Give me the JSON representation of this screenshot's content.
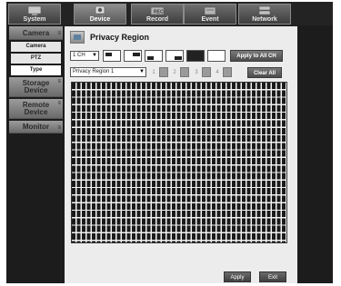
{
  "topnav": {
    "tabs": [
      {
        "label": "System",
        "icon": "system-monitor-icon"
      },
      {
        "label": "Device",
        "icon": "camera-icon"
      },
      {
        "label": "Record",
        "icon": "record-icon"
      },
      {
        "label": "Event",
        "icon": "event-icon"
      },
      {
        "label": "Network",
        "icon": "network-icon"
      }
    ],
    "active": "Device"
  },
  "sidebar": {
    "camera": {
      "label": "Camera",
      "subs": [
        "Camera",
        "PTZ",
        "Type"
      ]
    },
    "storage": {
      "label1": "Storage",
      "label2": "Device"
    },
    "remote": {
      "label1": "Remote",
      "label2": "Device"
    },
    "monitor": {
      "label": "Monitor"
    }
  },
  "main": {
    "title": "Privacy Region",
    "channel_select": "1 CH",
    "apply_all_label": "Apply to All CH",
    "region_select": "Privacy Region 1",
    "region_numbers": [
      "1",
      "2",
      "3",
      "4"
    ],
    "clear_all_label": "Clear All",
    "apply_label": "Apply",
    "exit_label": "Exit"
  },
  "colors": {
    "nav_bg": "#232323",
    "content_bg": "#ececec",
    "mask_cell": "#1a1a1a",
    "button_grey": "#5a5a5a"
  }
}
